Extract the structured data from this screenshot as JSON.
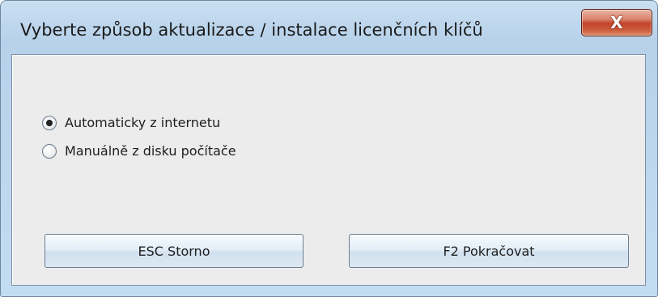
{
  "dialog": {
    "title": "Vyberte způsob aktualizace / instalace licenčních klíčů",
    "close_glyph": "X"
  },
  "options": [
    {
      "label": "Automaticky z internetu",
      "checked": true
    },
    {
      "label": "Manuálně z disku počítače",
      "checked": false
    }
  ],
  "buttons": {
    "cancel_label": "ESC Storno",
    "continue_label": "F2 Pokračovat"
  },
  "icons": {
    "close": "close-icon"
  },
  "colors": {
    "title_bar": "#bcd6ee",
    "close_button": "#c2452b",
    "client_bg": "#ececec",
    "button_bg": "#e4eef8"
  }
}
